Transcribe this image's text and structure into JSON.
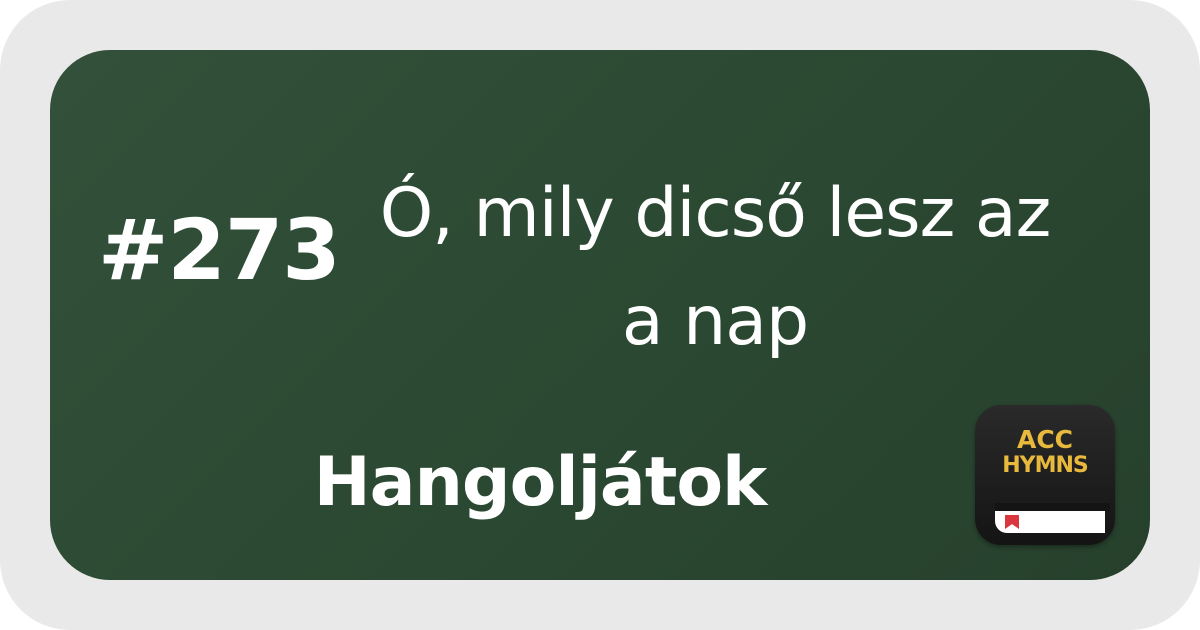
{
  "hymn": {
    "number": "#273",
    "title": "Ó, mily dicső lesz az a nap",
    "section": "Hangoljátok"
  },
  "logo": {
    "line1": "ACC",
    "line2": "HYMNS",
    "text_color": "#e8b93c",
    "bookmark_color": "#d9363e"
  },
  "colors": {
    "card_background": "#2e4c35",
    "frame_background": "#e9e9e9",
    "text": "#ffffff"
  }
}
